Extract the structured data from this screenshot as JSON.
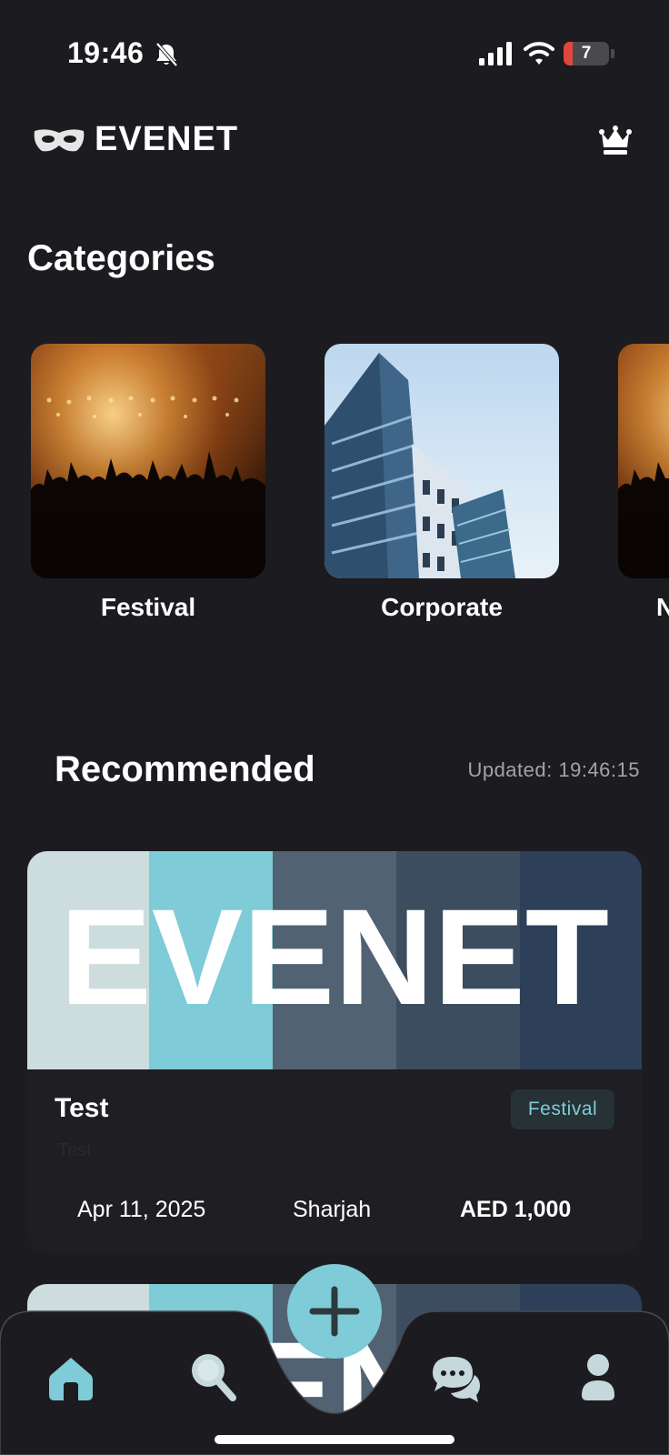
{
  "status_bar": {
    "time": "19:46",
    "battery_level": "7"
  },
  "header": {
    "app_name": "EVENET"
  },
  "categories": {
    "title": "Categories",
    "items": [
      {
        "label": "Festival"
      },
      {
        "label": "Corporate"
      },
      {
        "label": "N"
      }
    ]
  },
  "recommended": {
    "title": "Recommended",
    "updated": "Updated: 19:46:15",
    "events": [
      {
        "banner_text": "EVENET",
        "title": "Test",
        "category": "Festival",
        "description": "Test",
        "date": "Apr 11, 2025",
        "location": "Sharjah",
        "price": "AED 1,000"
      },
      {
        "banner_text": "EVENET"
      }
    ]
  },
  "colors": {
    "background": "#1c1b1f",
    "accent": "#7fcbd7",
    "banner_stripes": [
      "#cdddde",
      "#7fcbd7",
      "#516373",
      "#3d4d60",
      "#2d3f59"
    ]
  },
  "bottom_nav": {
    "items": [
      {
        "icon": "home-icon",
        "active": true
      },
      {
        "icon": "search-icon",
        "active": false
      },
      {
        "icon": "plus-icon",
        "active": false
      },
      {
        "icon": "chat-icon",
        "active": false
      },
      {
        "icon": "profile-icon",
        "active": false
      }
    ]
  }
}
